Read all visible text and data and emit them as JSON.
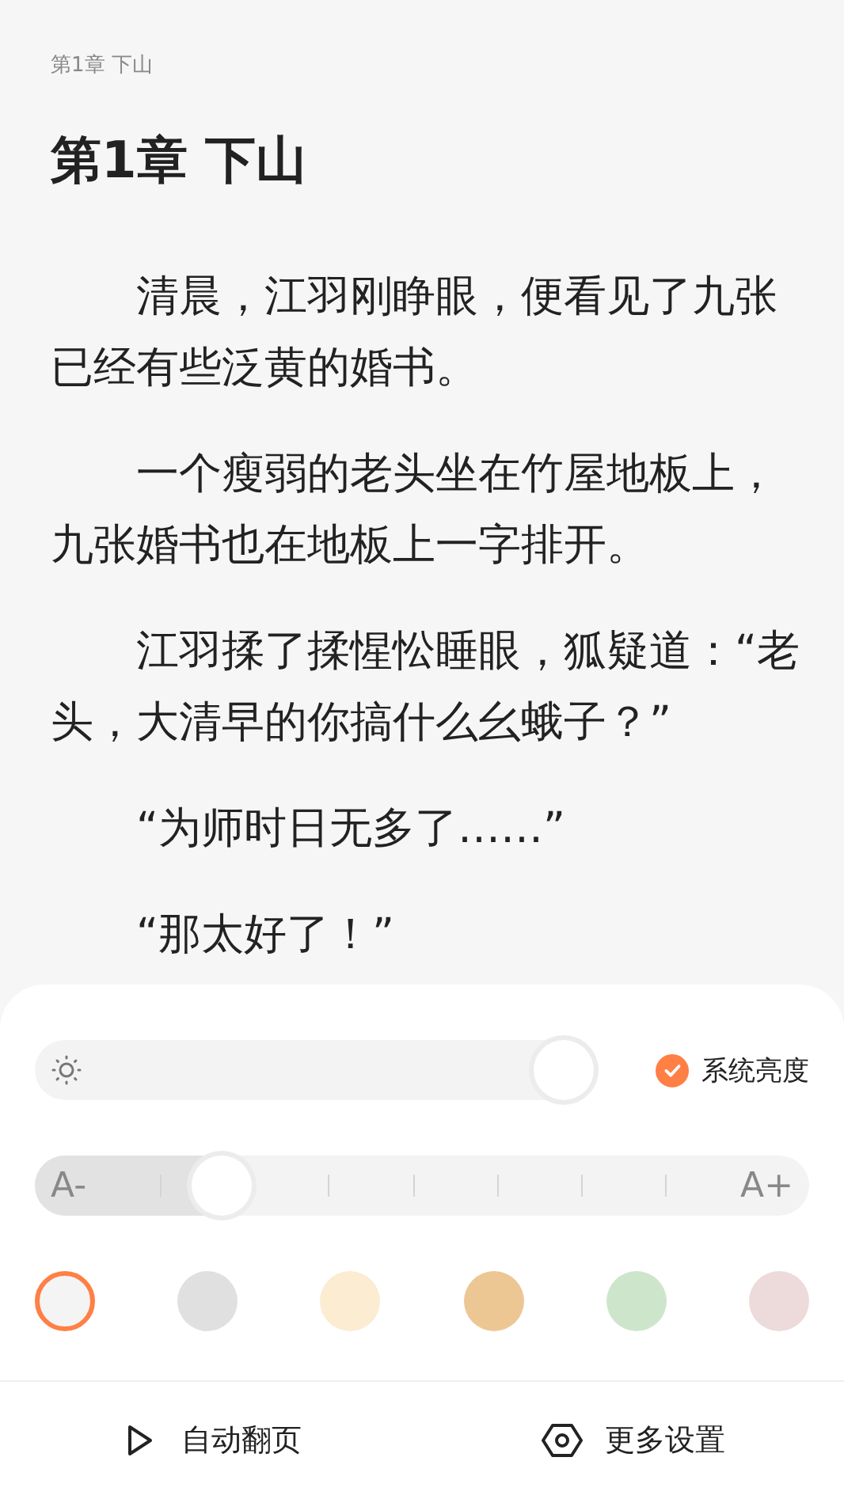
{
  "header": {
    "breadcrumb": "第1章 下山"
  },
  "chapter": {
    "title": "第1章 下山",
    "paragraphs": [
      "清晨，江羽刚睁眼，便看见了九张已经有些泛黄的婚书。",
      "一个瘦弱的老头坐在竹屋地板上，九张婚书也在地板上一字排开。",
      "江羽揉了揉惺忪睡眼，狐疑道：“老头，大清早的你搞什么幺蛾子？”",
      "“为师时日无多了……”",
      "“那太好了！”"
    ]
  },
  "settings": {
    "brightness": {
      "level": 1,
      "system_brightness": {
        "label": "系统亮度",
        "checked": true
      }
    },
    "font_size": {
      "decrease": "A-",
      "increase": "A+",
      "level": 0.22
    },
    "themes": [
      {
        "color": "#f4f4f4",
        "selected": true
      },
      {
        "color": "#e0e0e0",
        "selected": false
      },
      {
        "color": "#fbecd2",
        "selected": false
      },
      {
        "color": "#ecc794",
        "selected": false
      },
      {
        "color": "#cde6cb",
        "selected": false
      },
      {
        "color": "#eddadb",
        "selected": false
      }
    ],
    "actions": [
      {
        "kind": "play",
        "label": "自动翻页"
      },
      {
        "kind": "settings",
        "label": "更多设置"
      }
    ]
  }
}
